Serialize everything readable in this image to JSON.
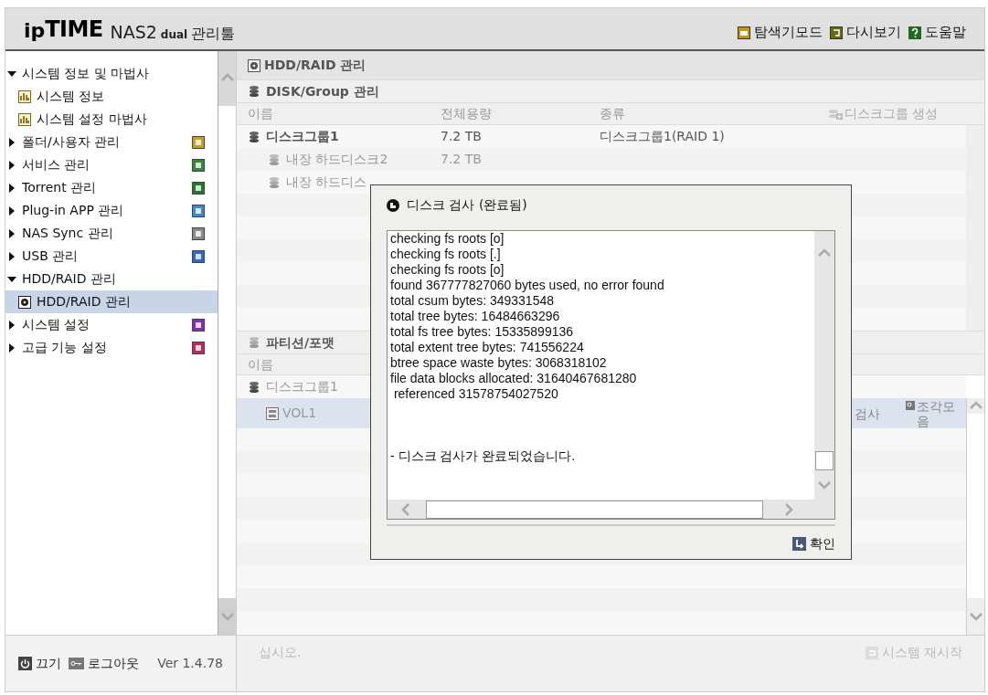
{
  "header": {
    "logo": {
      "prefix": "ip",
      "brand": "TIME",
      "product": "NAS2",
      "edition": "dual",
      "suffix": "관리툴"
    },
    "links": [
      {
        "kind": "explorer",
        "label": "탐색기모드"
      },
      {
        "kind": "refresh",
        "label": "다시보기"
      },
      {
        "kind": "help",
        "label": "도움말"
      }
    ]
  },
  "sidebar": {
    "items": [
      {
        "label": "시스템 정보 및 마법사",
        "expanded": true,
        "selected": false,
        "children": [
          {
            "label": "시스템 정보",
            "kind": "chart",
            "selected": false
          },
          {
            "label": "시스템 설정 마법사",
            "kind": "chart",
            "selected": false
          }
        ]
      },
      {
        "label": "폴더/사용자 관리",
        "expanded": false,
        "selected": false,
        "color": "#c8a020"
      },
      {
        "label": "서비스 관리",
        "expanded": false,
        "selected": false,
        "color": "#2f8a3a"
      },
      {
        "label": "Torrent 관리",
        "expanded": false,
        "selected": false,
        "color": "#1f7a2a"
      },
      {
        "label": "Plug-in APP 관리",
        "expanded": false,
        "selected": false,
        "color": "#3a8ad8"
      },
      {
        "label": "NAS Sync 관리",
        "expanded": false,
        "selected": false,
        "color": "#8a8a8a"
      },
      {
        "label": "USB 관리",
        "expanded": false,
        "selected": false,
        "color": "#2a6ad0"
      },
      {
        "label": "HDD/RAID 관리",
        "expanded": true,
        "selected": false,
        "children": [
          {
            "label": "HDD/RAID 관리",
            "kind": "disk",
            "selected": true
          }
        ]
      },
      {
        "label": "시스템 설정",
        "expanded": false,
        "selected": false,
        "color": "#8a2ab0"
      },
      {
        "label": "고급 기능 설정",
        "expanded": false,
        "selected": false,
        "color": "#c02a5a"
      }
    ],
    "footer": {
      "power": "끄기",
      "logout": "로그아웃",
      "version": "Ver 1.4.78"
    }
  },
  "main": {
    "title": "HDD/RAID 관리",
    "disk_group": {
      "title": "DISK/Group 관리",
      "columns": [
        "이름",
        "전체용량",
        "종류"
      ],
      "create_button": {
        "label": "디스크그룹 생성",
        "disabled": true
      },
      "rows": [
        {
          "kind": "group",
          "name": "디스크그룹1",
          "capacity": "7.2 TB",
          "type": "디스크그룹1(RAID 1)"
        },
        {
          "kind": "disk",
          "name": "내장 하드디스크2",
          "capacity": "7.2 TB"
        },
        {
          "kind": "disk",
          "name": "내장 하드디스"
        }
      ]
    },
    "partition": {
      "title": "파티션/포맷",
      "columns": [
        "이름"
      ],
      "rows": [
        {
          "kind": "group",
          "name": "디스크그룹1",
          "selected": false
        },
        {
          "kind": "volume",
          "name": "VOL1",
          "selected": true,
          "actions": [
            "검사",
            "조각모음"
          ]
        }
      ]
    },
    "footer": {
      "hint": "십시오.",
      "restart_button": {
        "label": "시스템 재시작",
        "disabled": true
      }
    }
  },
  "dialog": {
    "title": "디스크 검사 (완료됨)",
    "log": [
      "checking fs roots [o]",
      "checking fs roots [.]",
      "checking fs roots [o]",
      "found 367777827060 bytes used, no error found",
      "total csum bytes: 349331548",
      "total tree bytes: 16484663296",
      "total fs tree bytes: 15335899136",
      "total extent tree bytes: 741556224",
      "btree space waste bytes: 3068318102",
      "file data blocks allocated: 31640467681280",
      " referenced 31578754027520"
    ],
    "message": "- 디스크 검사가 완료되었습니다.",
    "ok_button": "확인"
  }
}
